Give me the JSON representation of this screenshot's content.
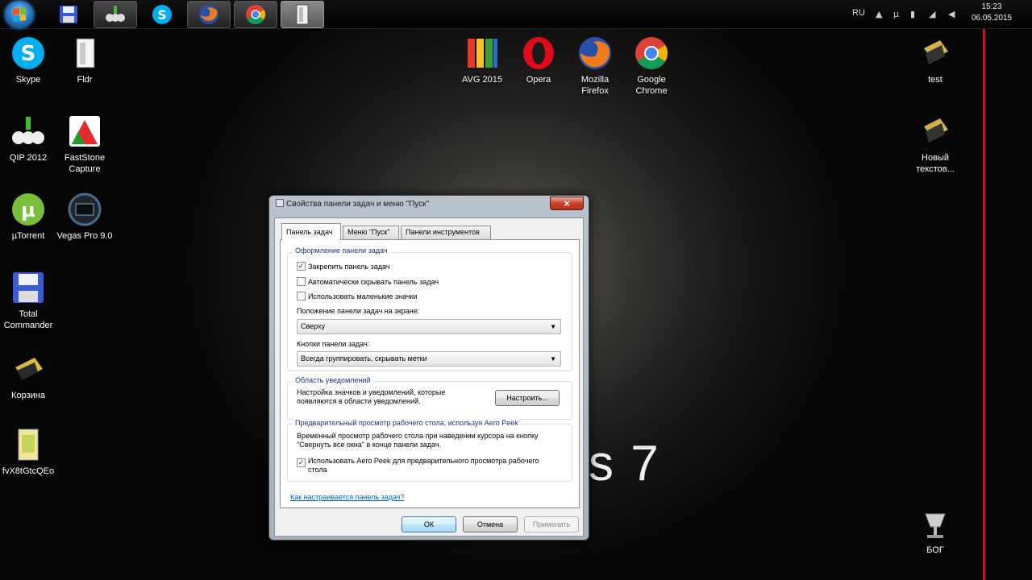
{
  "taskbar": {
    "buttons": [
      "start",
      "total-commander",
      "qip",
      "skype",
      "firefox",
      "chrome",
      "fldr"
    ],
    "tray": {
      "lang": "RU",
      "time": "15:23",
      "date": "06.05.2015"
    }
  },
  "desktop": {
    "icons_left": [
      {
        "label": "Skype",
        "name": "skype"
      },
      {
        "label": "Fldr",
        "name": "fldr"
      },
      {
        "label": "QIP 2012",
        "name": "qip"
      },
      {
        "label": "FastStone Capture",
        "name": "faststone"
      },
      {
        "label": "µTorrent",
        "name": "utorrent"
      },
      {
        "label": "Vegas Pro 9.0",
        "name": "vegas"
      },
      {
        "label": "Total Commander",
        "name": "total-commander"
      },
      {
        "label": "Корзина",
        "name": "recycle-bin"
      },
      {
        "label": "fvX8tGtcQEo",
        "name": "fvx"
      }
    ],
    "icons_top": [
      {
        "label": "AVG 2015",
        "name": "avg"
      },
      {
        "label": "Opera",
        "name": "opera"
      },
      {
        "label": "Mozilla Firefox",
        "name": "firefox"
      },
      {
        "label": "Google Chrome",
        "name": "chrome"
      }
    ],
    "icons_right": [
      {
        "label": "test",
        "name": "test"
      },
      {
        "label": "Новый текстов...",
        "name": "new-text"
      },
      {
        "label": "БОГ",
        "name": "bog"
      }
    ],
    "wallpaper_text": "s 7"
  },
  "dialog": {
    "title": "Свойства панели задач и меню \"Пуск\"",
    "close": "×",
    "tabs": [
      "Панель задач",
      "Меню \"Пуск\"",
      "Панели инструментов"
    ],
    "group1": {
      "title": "Оформление панели задач",
      "lock": {
        "label": "Закрепить панель задач",
        "checked": true
      },
      "autohide": {
        "label": "Автоматически скрывать панель задач",
        "checked": false
      },
      "small_icons": {
        "label": "Использовать маленькие значки",
        "checked": false
      },
      "position_label": "Положение панели задач на экране:",
      "position_value": "Сверху",
      "buttons_label": "Кнопки панели задач:",
      "buttons_value": "Всегда группировать, скрывать метки"
    },
    "group2": {
      "title": "Область уведомлений",
      "text": "Настройка значков и уведомлений, которые появляются в области уведомлений.",
      "button": "Настроить..."
    },
    "group3": {
      "title": "Предварительный просмотр рабочего стола, используя Aero Peek",
      "text": "Временный просмотр рабочего стола при наведении курсора на кнопку \"Свернуть все окна\" в конце панели задач.",
      "aero": {
        "label": "Использовать Aero Peek для предварительного просмотра рабочего стола",
        "checked": true
      }
    },
    "help_link": "Как настраивается панель задач?",
    "ok": "ОК",
    "cancel": "Отмена",
    "apply": "Применить"
  }
}
